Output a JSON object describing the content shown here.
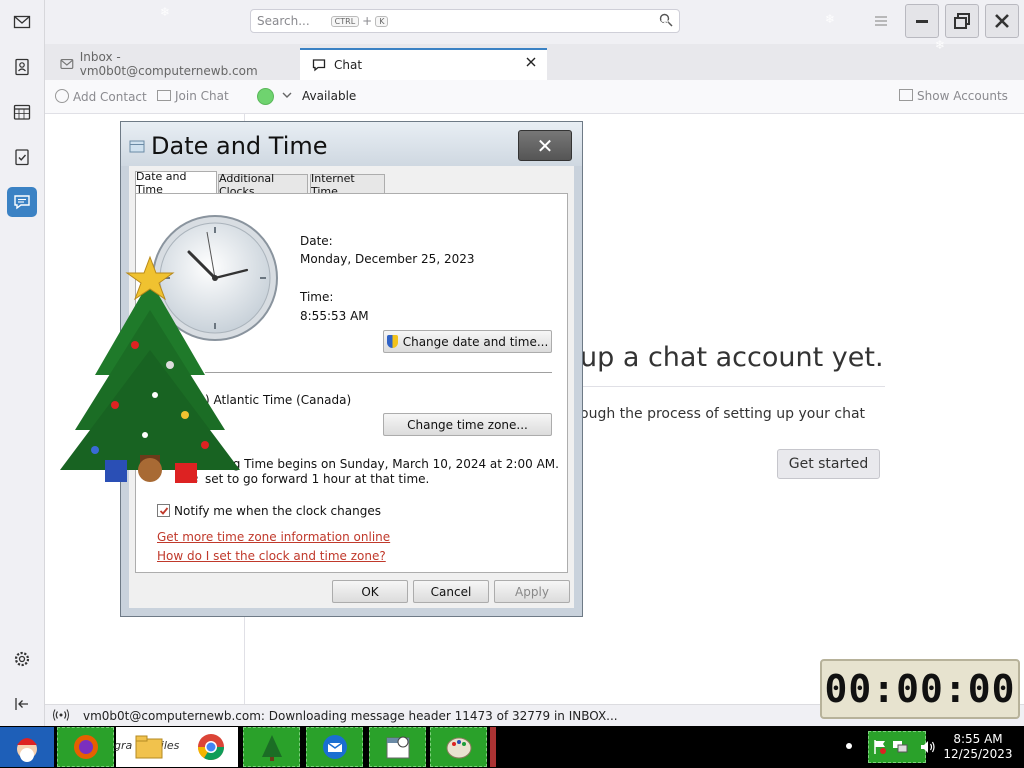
{
  "search": {
    "placeholder": "Search...",
    "kbd1": "CTRL",
    "plus": "+",
    "kbd2": "K"
  },
  "tabs": [
    {
      "label": "Inbox - vm0b0t@computernewb.com"
    },
    {
      "label": "Chat"
    }
  ],
  "chat_toolbar": {
    "add_contact": "Add Contact",
    "join_chat": "Join Chat",
    "status": "Available",
    "show_accounts": "Show Accounts"
  },
  "chat_main": {
    "title": "up a chat account yet.",
    "subtitle": "ough the process of setting up your chat",
    "get_started": "Get started"
  },
  "status_bar": {
    "text": "vm0b0t@computernewb.com: Downloading message header 11473 of 32779 in INBOX..."
  },
  "dialog": {
    "title": "Date and Time",
    "close": "✕",
    "tabs": [
      "Date and Time",
      "Additional Clocks",
      "Internet Time"
    ],
    "date_label": "Date:",
    "date_value": "Monday, December 25, 2023",
    "time_label": "Time:",
    "time_value": "8:55:53 AM",
    "change_datetime": "Change date and time...",
    "timezone": ") Atlantic Time (Canada)",
    "change_timezone": "Change time zone...",
    "dst_line1": "ght Saving Time begins on Sunday, March 10, 2024 at 2:00 AM. The",
    "dst_line2": "set to go forward 1 hour at that time.",
    "notify_label": "Notify me when the clock changes",
    "link1": "Get more time zone information online",
    "link2": "How do I set the clock and time zone?",
    "ok": "OK",
    "cancel": "Cancel",
    "apply": "Apply"
  },
  "timer": {
    "value": "00:00:00"
  },
  "taskbar": {
    "file_label": "gra    d files",
    "time": "8:55 AM",
    "date": "12/25/2023"
  },
  "colors": {
    "accent": "#3b82c4",
    "link": "#c0392b",
    "taskbar_item": "#2aa12a",
    "status_available": "#6fd36f"
  },
  "icons": [
    "mail-icon",
    "address-book-icon",
    "calendar-icon",
    "tasks-icon",
    "chat-icon",
    "settings-icon",
    "collapse-icon"
  ]
}
